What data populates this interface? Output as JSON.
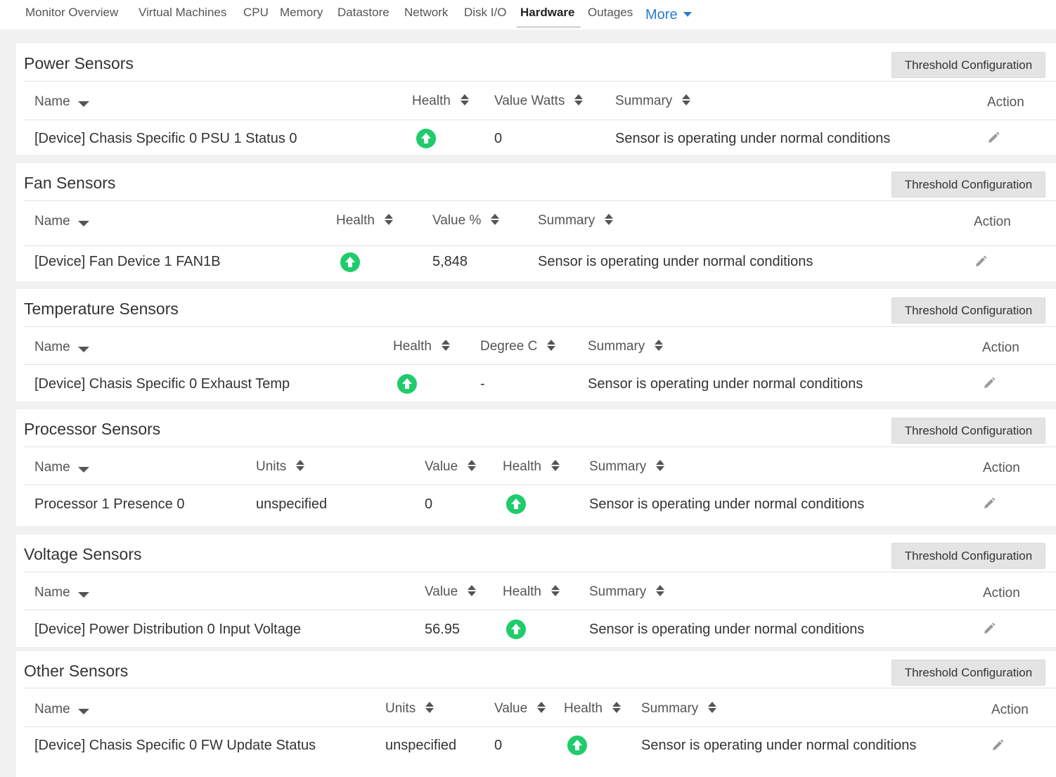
{
  "nav": {
    "tabs": [
      "Monitor Overview",
      "Virtual Machines",
      "CPU",
      "Memory",
      "Datastore",
      "Network",
      "Disk I/O",
      "Hardware",
      "Outages"
    ],
    "active": "Hardware",
    "more_label": "More"
  },
  "threshold_label": "Threshold Configuration",
  "action_label": "Action",
  "health_icon": "arrow-up-circle-icon",
  "health_color": "#1fcc6b",
  "power": {
    "title": "Power Sensors",
    "columns": [
      "Name",
      "Health",
      "Value Watts",
      "Summary"
    ],
    "row": {
      "name": "[Device] Chasis Specific 0 PSU 1 Status 0",
      "value": "0",
      "summary": "Sensor is operating under normal conditions"
    }
  },
  "fan": {
    "title": "Fan Sensors",
    "columns": [
      "Name",
      "Health",
      "Value %",
      "Summary"
    ],
    "row": {
      "name": "[Device] Fan Device 1 FAN1B",
      "value": "5,848",
      "summary": "Sensor is operating under normal conditions"
    }
  },
  "temperature": {
    "title": "Temperature Sensors",
    "columns": [
      "Name",
      "Health",
      "Degree C",
      "Summary"
    ],
    "row": {
      "name": "[Device] Chasis Specific 0 Exhaust Temp",
      "value": "-",
      "summary": "Sensor is operating under normal conditions"
    }
  },
  "processor": {
    "title": "Processor Sensors",
    "columns": [
      "Name",
      "Units",
      "Value",
      "Health",
      "Summary"
    ],
    "row": {
      "name": "Processor 1 Presence 0",
      "units": "unspecified",
      "value": "0",
      "summary": "Sensor is operating under normal conditions"
    }
  },
  "voltage": {
    "title": "Voltage Sensors",
    "columns": [
      "Name",
      "Value",
      "Health",
      "Summary"
    ],
    "row": {
      "name": "[Device] Power Distribution 0 Input Voltage",
      "value": "56.95",
      "summary": "Sensor is operating under normal conditions"
    }
  },
  "other": {
    "title": "Other Sensors",
    "columns": [
      "Name",
      "Units",
      "Value",
      "Health",
      "Summary"
    ],
    "row": {
      "name": "[Device] Chasis Specific 0 FW Update Status",
      "units": "unspecified",
      "value": "0",
      "summary": "Sensor is operating under normal conditions"
    }
  }
}
